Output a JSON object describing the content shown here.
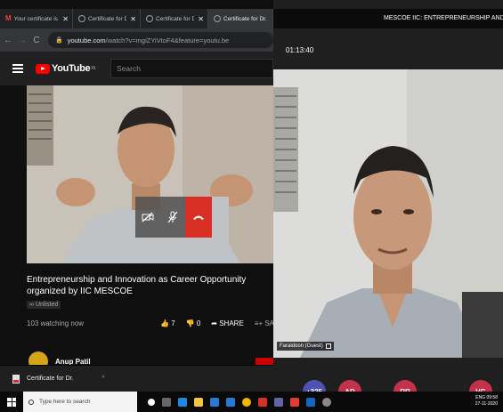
{
  "browser": {
    "tabs": [
      {
        "title": "Your certificate is in",
        "favicon": "gmail-icon",
        "active": false
      },
      {
        "title": "Certificate for Dr. A",
        "favicon": "globe-icon",
        "active": false
      },
      {
        "title": "Certificate for Dr. A",
        "favicon": "globe-icon",
        "active": false
      },
      {
        "title": "Certificate for Dr.",
        "favicon": "globe-icon",
        "active": true
      }
    ],
    "url_host": "youtube.com",
    "url_path": "/watch?v=mgiZYiVtoF4&feature=youtu.be"
  },
  "youtube": {
    "logo_text": "YouTube",
    "logo_sup": "IN",
    "search_placeholder": "Search",
    "video_title": "Entrepreneurship and Innovation as Career Opportunity organized by IIC MESCOE",
    "unlisted_label": "Unlisted",
    "watching_text": "103 watching now",
    "likes": "7",
    "dislikes": "0",
    "share_label": "SHARE",
    "save_label": "SA",
    "channel_name": "Anup Patil"
  },
  "meeting": {
    "title": "MESCOE IIC: ENTREPRENEURSHIP AND IN",
    "timer": "01:13:40",
    "speaker_name": "Faraidoon (Guest)",
    "participants": [
      {
        "label": "+325",
        "color": "#4f52b2"
      },
      {
        "label": "AD",
        "color": "#c4314b"
      },
      {
        "label": "RR",
        "color": "#c4314b"
      },
      {
        "label": "VG",
        "color": "#c4314b"
      }
    ]
  },
  "download": {
    "file_name": "Certificate for Dr."
  },
  "taskbar": {
    "search_placeholder": "Type here to search",
    "time": "09:58",
    "date": "27-11-2020",
    "lang": "ENG"
  },
  "colors": {
    "youtube_red": "#ff0000",
    "end_call_red": "#d93025",
    "teams_avatar": "#c4314b"
  }
}
